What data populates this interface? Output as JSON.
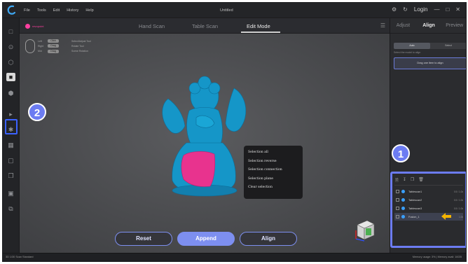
{
  "titlebar": {
    "menu": [
      "File",
      "Tools",
      "Edit",
      "History",
      "Help"
    ],
    "window_title": "Untitled",
    "login": "Login"
  },
  "mode_tabs": {
    "brand": "revopoint",
    "tabs": [
      "Hand Scan",
      "Table Scan",
      "Edit Mode"
    ],
    "active": "Edit Mode"
  },
  "mouse_hints": [
    [
      "Left",
      "Click",
      "Select/Adjust Tool"
    ],
    [
      "Right",
      "Drag",
      "Rotate Tool"
    ],
    [
      "Mid",
      "Drag",
      "Scene Rotation"
    ]
  ],
  "context_menu": [
    "Selection all",
    "Selection reverse",
    "Selection connection",
    "Selection plane",
    "Clear selection"
  ],
  "actions": {
    "reset": "Reset",
    "append": "Append",
    "align": "Align"
  },
  "right_panel": {
    "tabs": [
      "Adjust",
      "Align",
      "Preview"
    ],
    "active_tab": "Align",
    "segments": [
      "Auto",
      "Select"
    ],
    "hint": "Select the model to align",
    "dropzone": "Drag one item to align"
  },
  "projects": [
    {
      "name": "Tablescan1",
      "meta": "0.5 / 1.0k",
      "selected": false
    },
    {
      "name": "Tablescan2",
      "meta": "0.5 / 1.0k",
      "selected": false
    },
    {
      "name": "Tablescan3",
      "meta": "0.5 / 1.0k",
      "selected": false
    },
    {
      "name": "Fusion_1",
      "meta": "1.0k",
      "selected": true
    }
  ],
  "callouts": {
    "one": "1",
    "two": "2"
  },
  "status": {
    "left": "3D 1/30 Scan Standard",
    "right": "Memory usage: 3% | Memory avail: 16GB"
  },
  "colors": {
    "accent": "#6c7cf2",
    "model": "#1596c8",
    "selection": "#e8338e",
    "brand": "#ff3fa0"
  }
}
